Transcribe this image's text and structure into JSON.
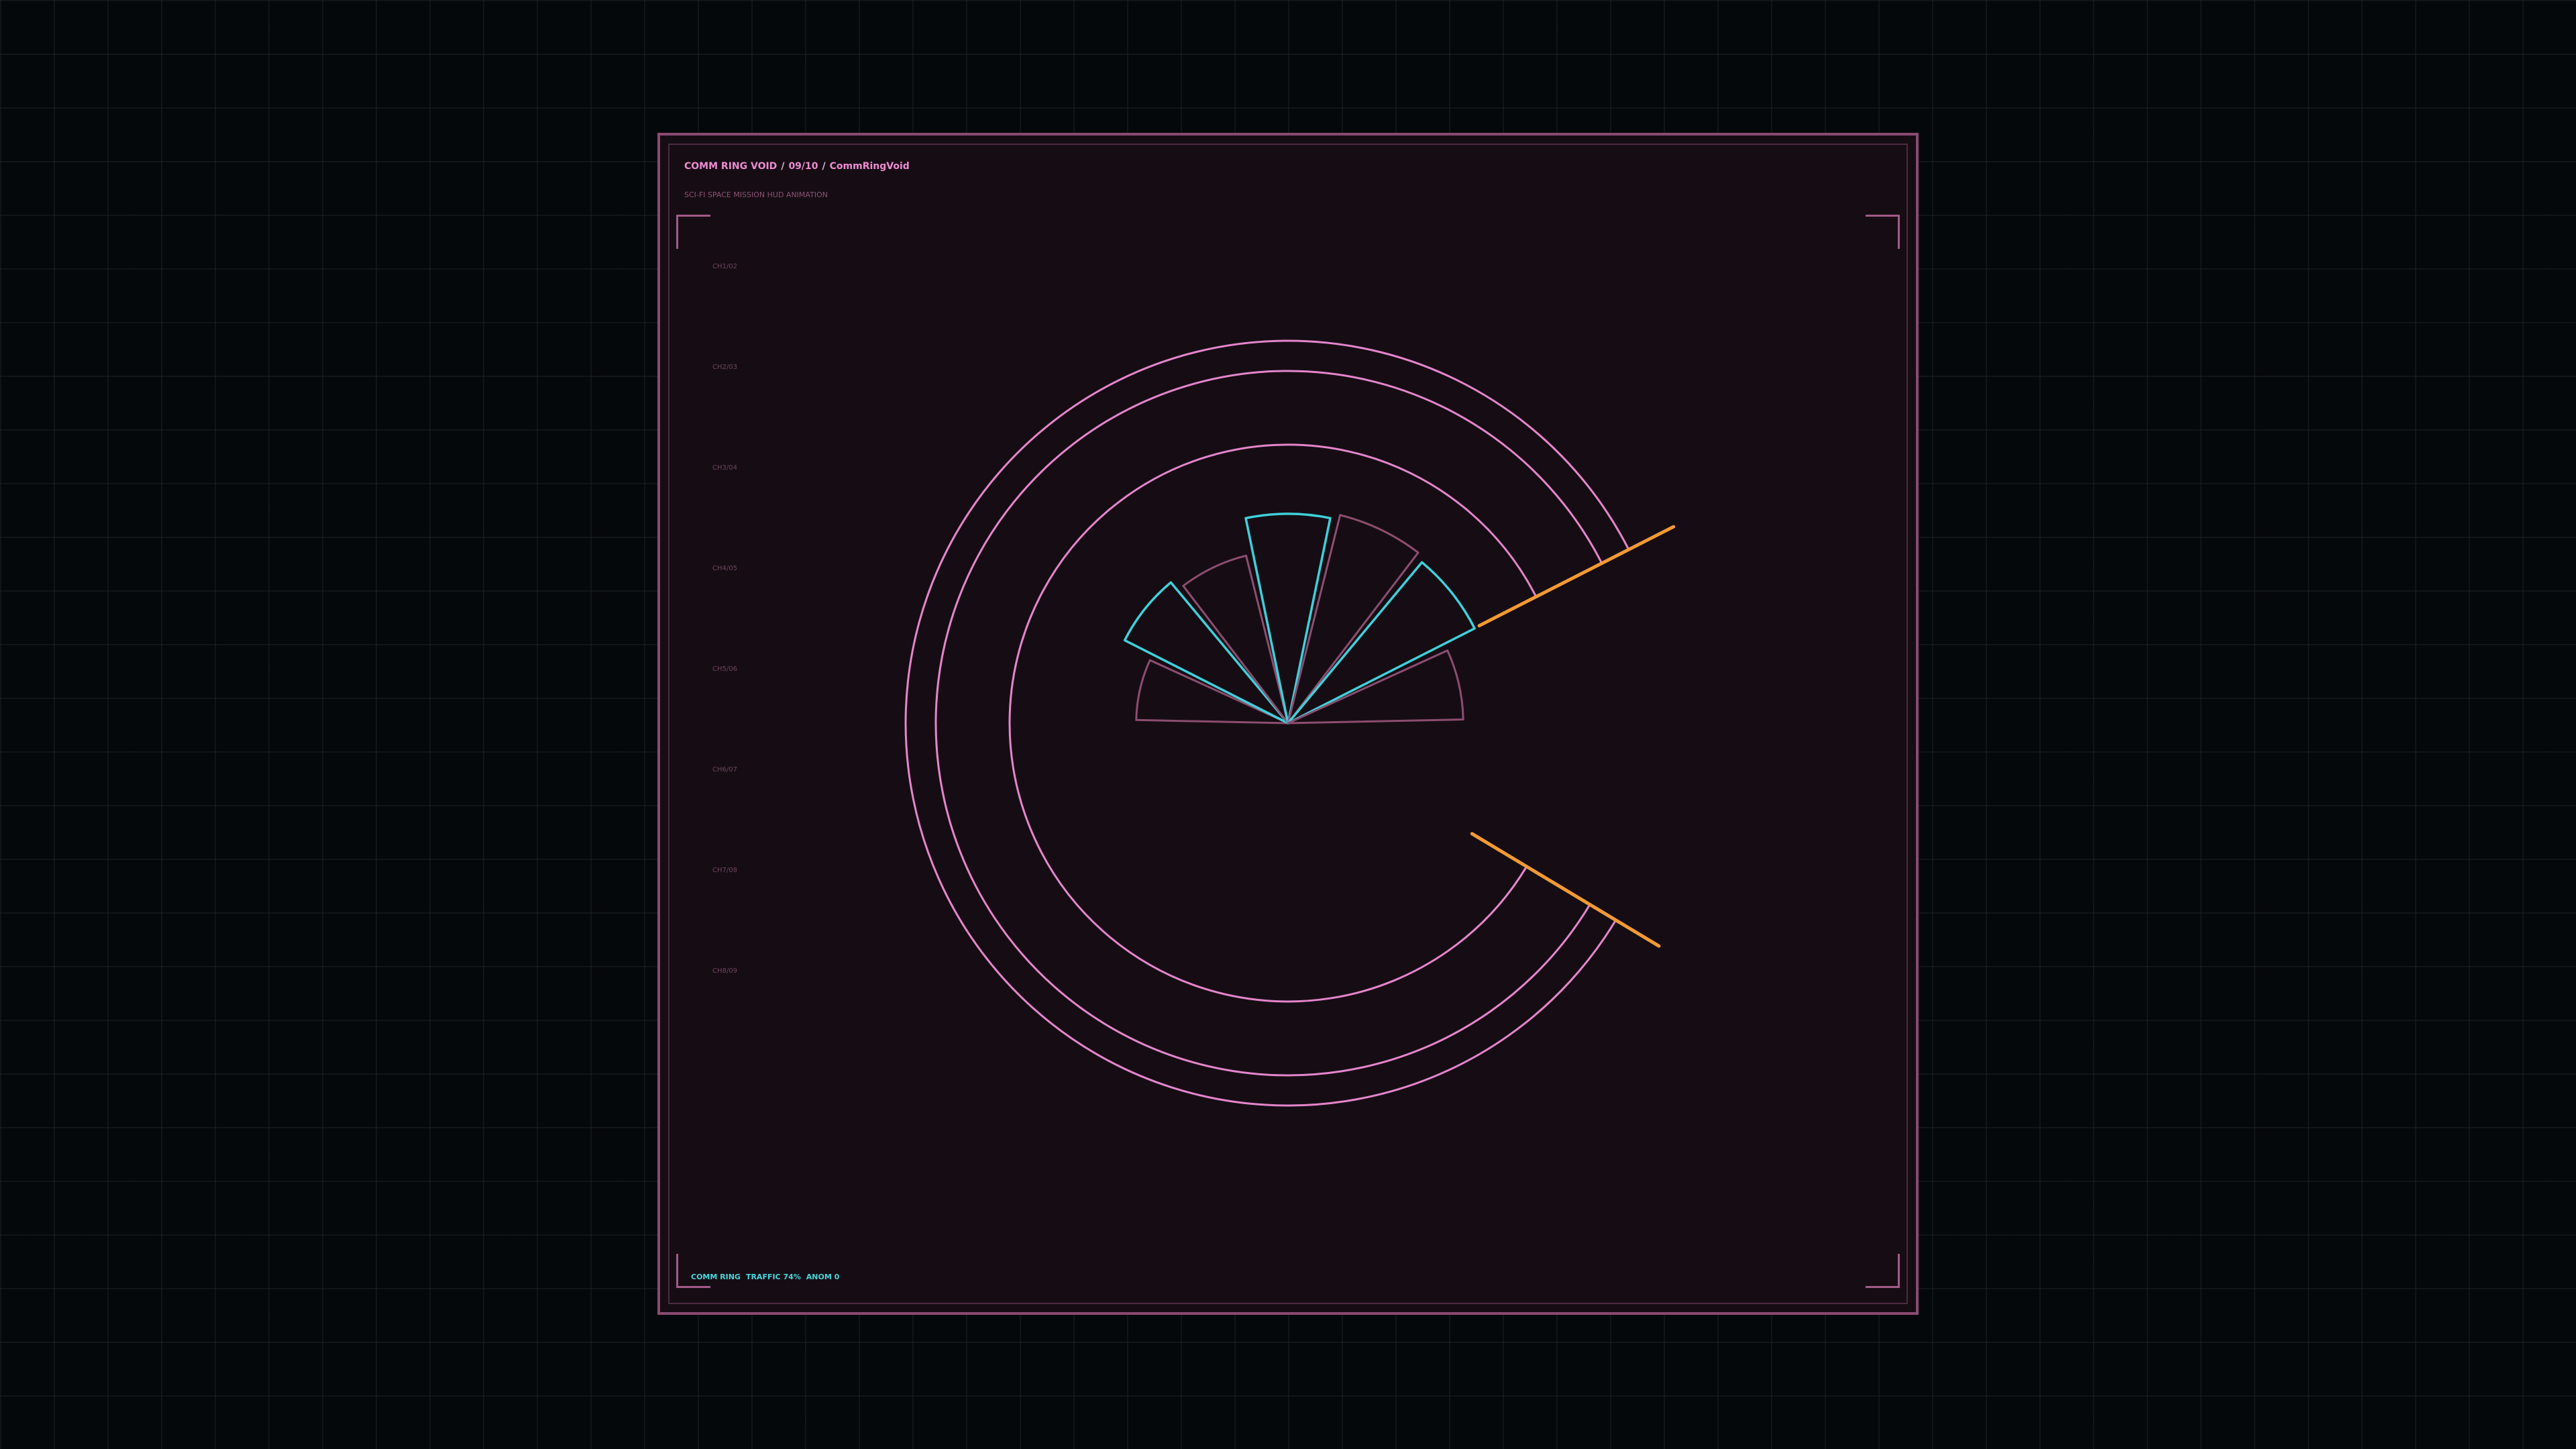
{
  "header": {
    "title": "COMM RING VOID",
    "index": "09/10",
    "name": "CommRingVoid",
    "subtitle": "SCI-FI SPACE MISSION HUD ANIMATION"
  },
  "channels": [
    "CH1/02",
    "CH2/03",
    "CH3/04",
    "CH4/05",
    "CH5/06",
    "CH6/07",
    "CH7/08",
    "CH8/09"
  ],
  "status": {
    "label": "COMM RING",
    "traffic": "TRAFFIC 74%",
    "anomalies": "ANOM 0"
  },
  "rings": {
    "gap_start_deg": -27,
    "gap_end_deg": 31,
    "fan_wedge_highlight": [
      false,
      true,
      false,
      true,
      false,
      true,
      false
    ],
    "fan_wedge_levels": [
      0.58,
      0.7,
      0.66,
      0.8,
      0.82,
      0.8,
      0.67
    ]
  },
  "colors": {
    "background": "#05080b",
    "panel": "#160d14",
    "panel_border": "#8a4a72",
    "ring": "#e585cc",
    "wedge": "#8c4d70",
    "wedge_highlight": "#3fd0da",
    "marker": "#f29a33",
    "title": "#ec8cd0"
  }
}
